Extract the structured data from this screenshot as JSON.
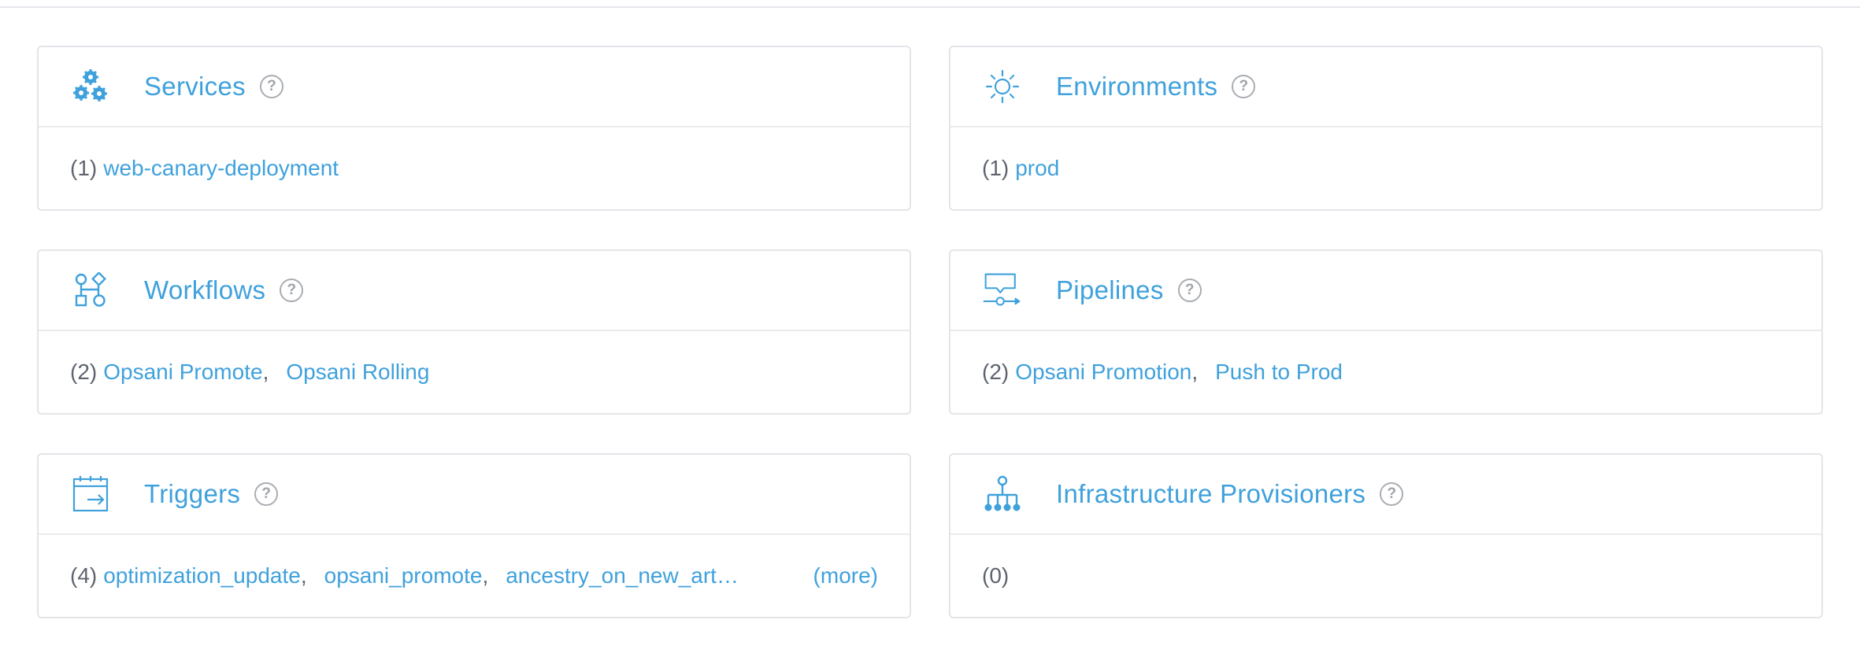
{
  "cards": [
    {
      "title": "Services",
      "icon": "services-gears-icon",
      "count": "(1)",
      "items": [
        "web-canary-deployment"
      ]
    },
    {
      "title": "Environments",
      "icon": "environments-sun-icon",
      "count": "(1)",
      "items": [
        "prod"
      ]
    },
    {
      "title": "Workflows",
      "icon": "workflows-shapes-icon",
      "count": "(2)",
      "items": [
        "Opsani Promote",
        "Opsani Rolling"
      ]
    },
    {
      "title": "Pipelines",
      "icon": "pipelines-icon",
      "count": "(2)",
      "items": [
        "Opsani Promotion",
        "Push to Prod"
      ]
    },
    {
      "title": "Triggers",
      "icon": "triggers-calendar-icon",
      "count": "(4)",
      "items": [
        "optimization_update",
        "opsani_promote",
        "ancestry_on_new_artifact"
      ],
      "more_label": "(more)"
    },
    {
      "title": "Infrastructure Provisioners",
      "icon": "infrastructure-tree-icon",
      "count": "(0)",
      "items": []
    }
  ],
  "help_glyph": "?",
  "separator": ",",
  "colors": {
    "link": "#3fa1dc",
    "text": "#5d6470",
    "border": "#e3e5e9"
  }
}
